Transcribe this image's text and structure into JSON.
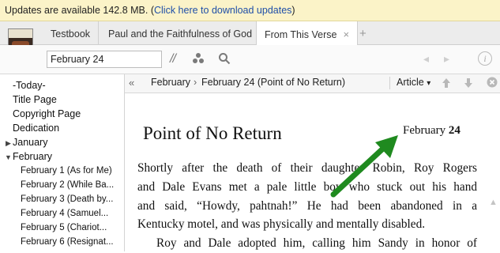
{
  "banner": {
    "text": "Updates are available 142.8 MB. (",
    "link": "Click here to download updates",
    "close": ")"
  },
  "tabs": [
    {
      "label": "Testbook"
    },
    {
      "label": "Paul and the Faithfulness of God"
    },
    {
      "label": "From This Verse"
    }
  ],
  "icons": {
    "close_tab": "×",
    "new_tab": "+",
    "parallel": "//",
    "dots": "⁘",
    "search": "search-icon",
    "back": "◂",
    "forward": "▸",
    "info": "i"
  },
  "toolbar": {
    "reference_value": "February 24"
  },
  "sidebar": {
    "items": [
      {
        "label": "-Today-"
      },
      {
        "label": "Title Page"
      },
      {
        "label": "Copyright Page"
      },
      {
        "label": "Dedication"
      },
      {
        "label": "January"
      },
      {
        "label": "February"
      }
    ],
    "subitems": [
      {
        "label": "February 1  (As for Me)"
      },
      {
        "label": "February 2 (While Ba..."
      },
      {
        "label": "February 3 (Death by..."
      },
      {
        "label": "February 4 (Samuel..."
      },
      {
        "label": "February 5  (Chariot..."
      },
      {
        "label": "February 6  (Resignat..."
      }
    ]
  },
  "navbar": {
    "collapse": "«",
    "crumb1": "February",
    "sep": "›",
    "crumb2": "February 24  (Point of No Return)",
    "view": "Article",
    "caret": "▾"
  },
  "article": {
    "title": "Point of No Return",
    "date_month": "February ",
    "date_day": "24",
    "para1_lines": [
      "Shortly after the death of their daughter Robin, Roy Rogers",
      "and Dale Evans met a pale little boy who stuck out his hand",
      "and said, “Howdy, pahtnah!” He had been abandoned in a",
      "Kentucky motel, and was physically and mentally disabled."
    ],
    "para2_line1": "Roy and Dale adopted him, calling him Sandy in honor of"
  },
  "colors": {
    "banner_bg": "#fbf3c8",
    "link": "#1f4fa8",
    "arrow": "#1f8a1f"
  }
}
